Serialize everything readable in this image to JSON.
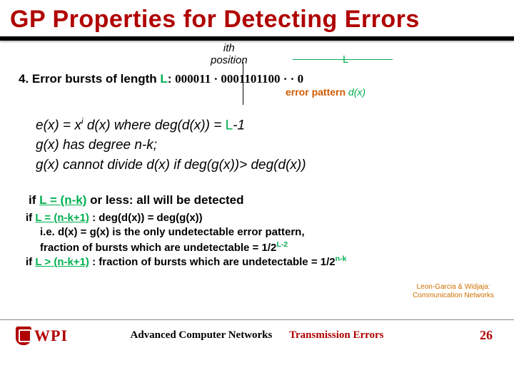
{
  "title": "GP Properties for Detecting Errors",
  "ith_line1": "ith",
  "ith_line2": "position",
  "L_label": "L",
  "item4_prefix": "4.  Error bursts of length ",
  "item4_L": "L",
  "item4_colon": ": ",
  "bits": "    000011  ·  0001101100  ·  ·  0",
  "error_pattern": "error pattern ",
  "dx": "d(x)",
  "eq1_a": "e(x) = x",
  "eq1_sup": "i",
  "eq1_b": "  d(x)       where deg(d(x)) = ",
  "eq1_c": "L",
  "eq1_d": "-1",
  "eq2": "g(x) has degree n-k;",
  "eq3": "g(x) cannot divide d(x)  if deg(g(x))> deg(d(x))",
  "cond1_a": "if  ",
  "cond1_b": "L = (n-k)",
  "cond1_c": "  or less:  all will be detected",
  "cond2_a": "if  ",
  "cond2_b": "L = (n-k+1)",
  "cond2_c": " :    deg(d(x)) = deg(g(x))",
  "cond3": "i.e.  d(x) = g(x) is the only undetectable error pattern,",
  "cond4_a": "fraction of bursts which are undetectable = 1/2",
  "cond4_sup": "L-2",
  "cond5_a": "if  ",
  "cond5_b": "L > (n-k+1)",
  "cond5_c": " :  fraction of bursts which are undetectable = 1/2",
  "cond5_sup": "n-k",
  "ref1": "Leon-Garcia & Widjaja:",
  "ref2": "Communication Networks",
  "logo_text": "WPI",
  "footer_center1": "Advanced Computer Networks",
  "footer_center2": "Transmission Errors",
  "page": "26"
}
